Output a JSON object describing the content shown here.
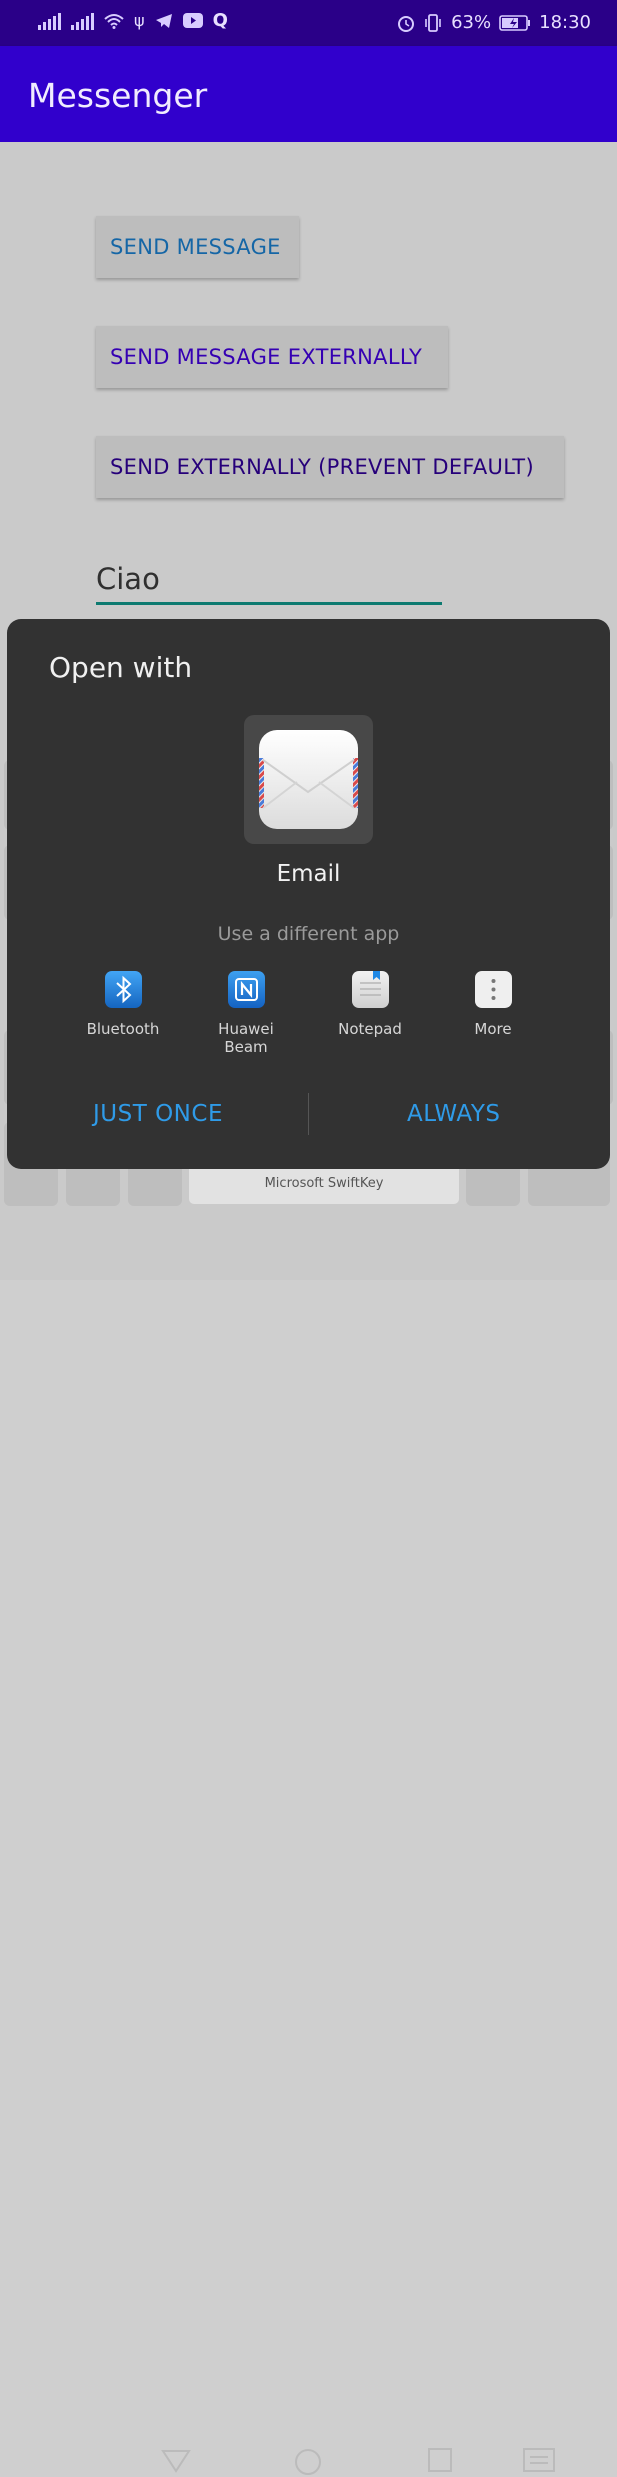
{
  "status_bar": {
    "battery": "63%",
    "time": "18:30"
  },
  "app_bar": {
    "title": "Messenger"
  },
  "main": {
    "send_message_label": "SEND MESSAGE",
    "send_external_label": "SEND MESSAGE EXTERNALLY",
    "send_prevent_label": "SEND EXTERNALLY (PREVENT DEFAULT)",
    "message_value": "Ciao"
  },
  "keyboard": {
    "spacebar_label": "Microsoft SwiftKey"
  },
  "dialog": {
    "title": "Open with",
    "suggested_app": "Email",
    "different_app_label": "Use a different app",
    "options": [
      {
        "label": "Bluetooth",
        "icon": "bluetooth-icon"
      },
      {
        "label": "Huawei\nBeam",
        "icon": "nfc-icon"
      },
      {
        "label": "Notepad",
        "icon": "notepad-icon"
      },
      {
        "label": "More",
        "icon": "more-vert-icon"
      }
    ],
    "just_once_label": "JUST ONCE",
    "always_label": "ALWAYS"
  },
  "colors": {
    "status_bar": "#2a0088",
    "app_bar": "#3100cc",
    "dialog_bg": "#323232",
    "accent": "#2f9be8",
    "input_underline": "#0d7a70"
  }
}
